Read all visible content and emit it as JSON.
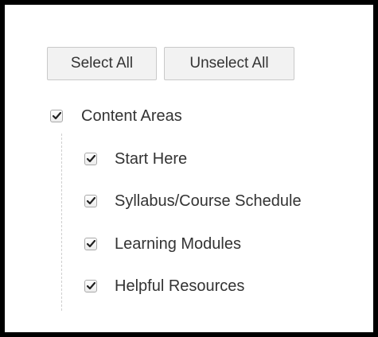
{
  "toolbar": {
    "select_all_label": "Select All",
    "unselect_all_label": "Unselect All"
  },
  "tree": {
    "root": {
      "label": "Content Areas",
      "checked": true
    },
    "children": [
      {
        "label": "Start Here",
        "checked": true
      },
      {
        "label": "Syllabus/Course Schedule",
        "checked": true
      },
      {
        "label": "Learning Modules",
        "checked": true
      },
      {
        "label": "Helpful Resources",
        "checked": true
      }
    ]
  },
  "colors": {
    "frame_border": "#000000",
    "text": "#333333",
    "button_bg": "#f2f2f2",
    "checkmark": "#222222"
  }
}
